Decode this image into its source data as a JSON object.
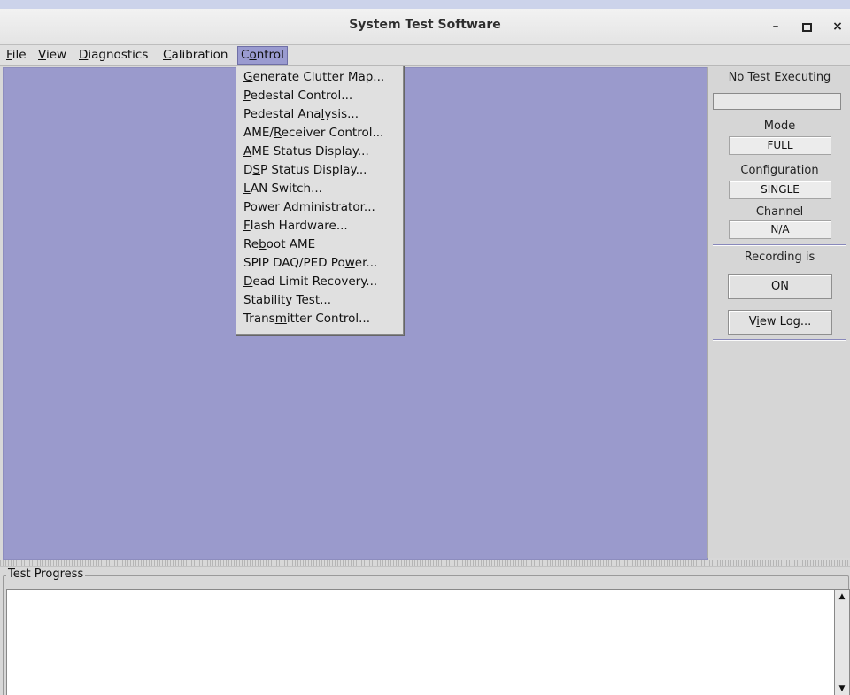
{
  "window": {
    "title": "System Test Software",
    "controls": {
      "minimize": "–",
      "close": "×"
    }
  },
  "menubar": {
    "items": [
      {
        "pre": "",
        "mn": "F",
        "post": "ile"
      },
      {
        "pre": "",
        "mn": "V",
        "post": "iew"
      },
      {
        "pre": "",
        "mn": "D",
        "post": "iagnostics"
      },
      {
        "pre": "",
        "mn": "C",
        "post": "alibration"
      },
      {
        "pre": "C",
        "mn": "o",
        "post": "ntrol"
      }
    ]
  },
  "control_menu": {
    "items": [
      {
        "pre": "",
        "mn": "G",
        "post": "enerate Clutter Map..."
      },
      {
        "pre": "",
        "mn": "P",
        "post": "edestal Control..."
      },
      {
        "pre": "Pedestal Ana",
        "mn": "l",
        "post": "ysis..."
      },
      {
        "pre": "AME/",
        "mn": "R",
        "post": "eceiver Control..."
      },
      {
        "pre": "",
        "mn": "A",
        "post": "ME Status Display..."
      },
      {
        "pre": "D",
        "mn": "S",
        "post": "P Status Display..."
      },
      {
        "pre": "",
        "mn": "L",
        "post": "AN Switch..."
      },
      {
        "pre": "P",
        "mn": "o",
        "post": "wer Administrator..."
      },
      {
        "pre": "",
        "mn": "F",
        "post": "lash Hardware..."
      },
      {
        "pre": "Re",
        "mn": "b",
        "post": "oot AME"
      },
      {
        "pre": "SPIP DAQ/PED Po",
        "mn": "w",
        "post": "er..."
      },
      {
        "pre": "",
        "mn": "D",
        "post": "ead Limit Recovery..."
      },
      {
        "pre": "S",
        "mn": "t",
        "post": "ability Test..."
      },
      {
        "pre": "Trans",
        "mn": "m",
        "post": "itter Control..."
      }
    ]
  },
  "side_panel": {
    "status": "No Test Executing",
    "mode_label": "Mode",
    "mode_value": "FULL",
    "configuration_label": "Configuration",
    "configuration_value": "SINGLE",
    "channel_label": "Channel",
    "channel_value": "N/A",
    "recording_label": "Recording is",
    "recording_value": "ON",
    "view_log": {
      "pre": "V",
      "mn": "i",
      "post": "ew Log..."
    }
  },
  "progress": {
    "legend": "Test Progress"
  },
  "icons": {
    "minimize": "minimize-icon",
    "maximize": "maximize-icon",
    "close": "close-icon",
    "scroll_up": "arrow-up-icon",
    "scroll_down": "arrow-down-icon"
  },
  "colors": {
    "canvas": "#9a9acc",
    "menu_highlight": "#9a9bd0",
    "desktop": "#ccd3ea"
  }
}
